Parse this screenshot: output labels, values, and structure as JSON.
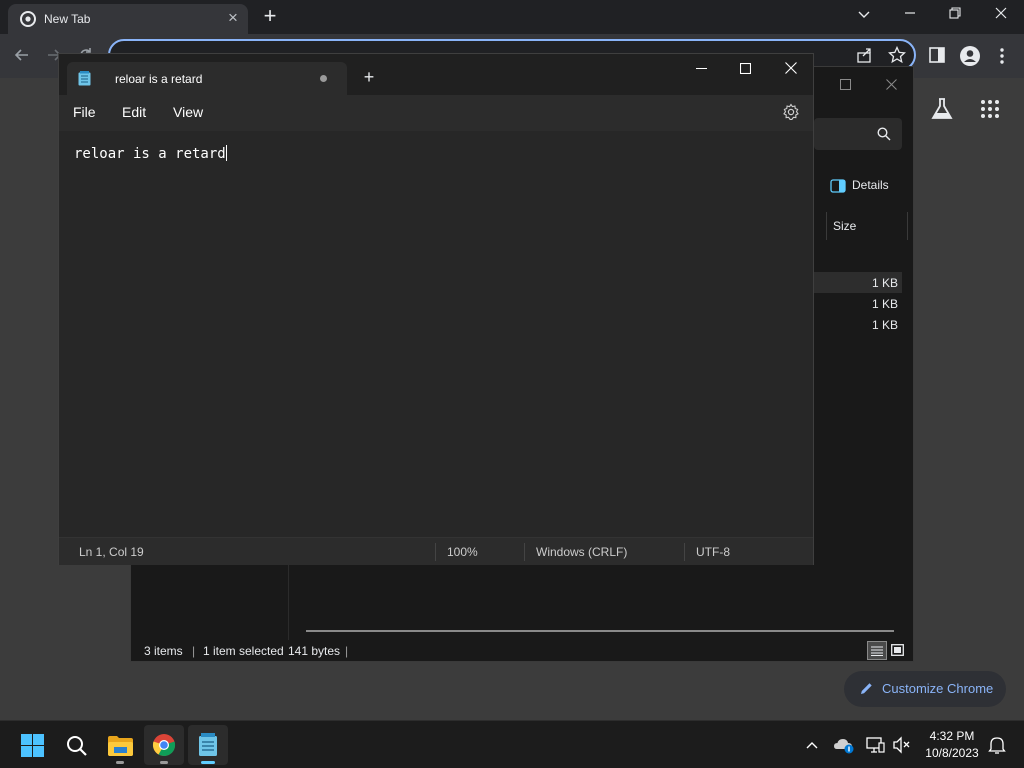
{
  "chrome": {
    "tab_title": "New Tab",
    "customize_label": "Customize Chrome"
  },
  "explorer": {
    "details_label": "Details",
    "size_header": "Size",
    "sizes": [
      "1 KB",
      "1 KB",
      "1 KB"
    ],
    "status": {
      "item_count": "3 items",
      "selection": "1 item selected",
      "selection_size": "141 bytes"
    }
  },
  "notepad": {
    "tab_title": "reloar is a retard",
    "menu": [
      "File",
      "Edit",
      "View"
    ],
    "content": "reloar is a retard",
    "status": {
      "position": "Ln 1, Col 19",
      "zoom": "100%",
      "line_ending": "Windows (CRLF)",
      "encoding": "UTF-8"
    }
  },
  "taskbar": {
    "time": "4:32 PM",
    "date": "10/8/2023",
    "apps": [
      "start-icon",
      "search-icon",
      "file-explorer-icon",
      "chrome-icon",
      "notepad-icon"
    ]
  },
  "colors": {
    "accent": "#8ab4f8",
    "windows_blue": "#60cdff",
    "notepad_bg": "#272727"
  }
}
